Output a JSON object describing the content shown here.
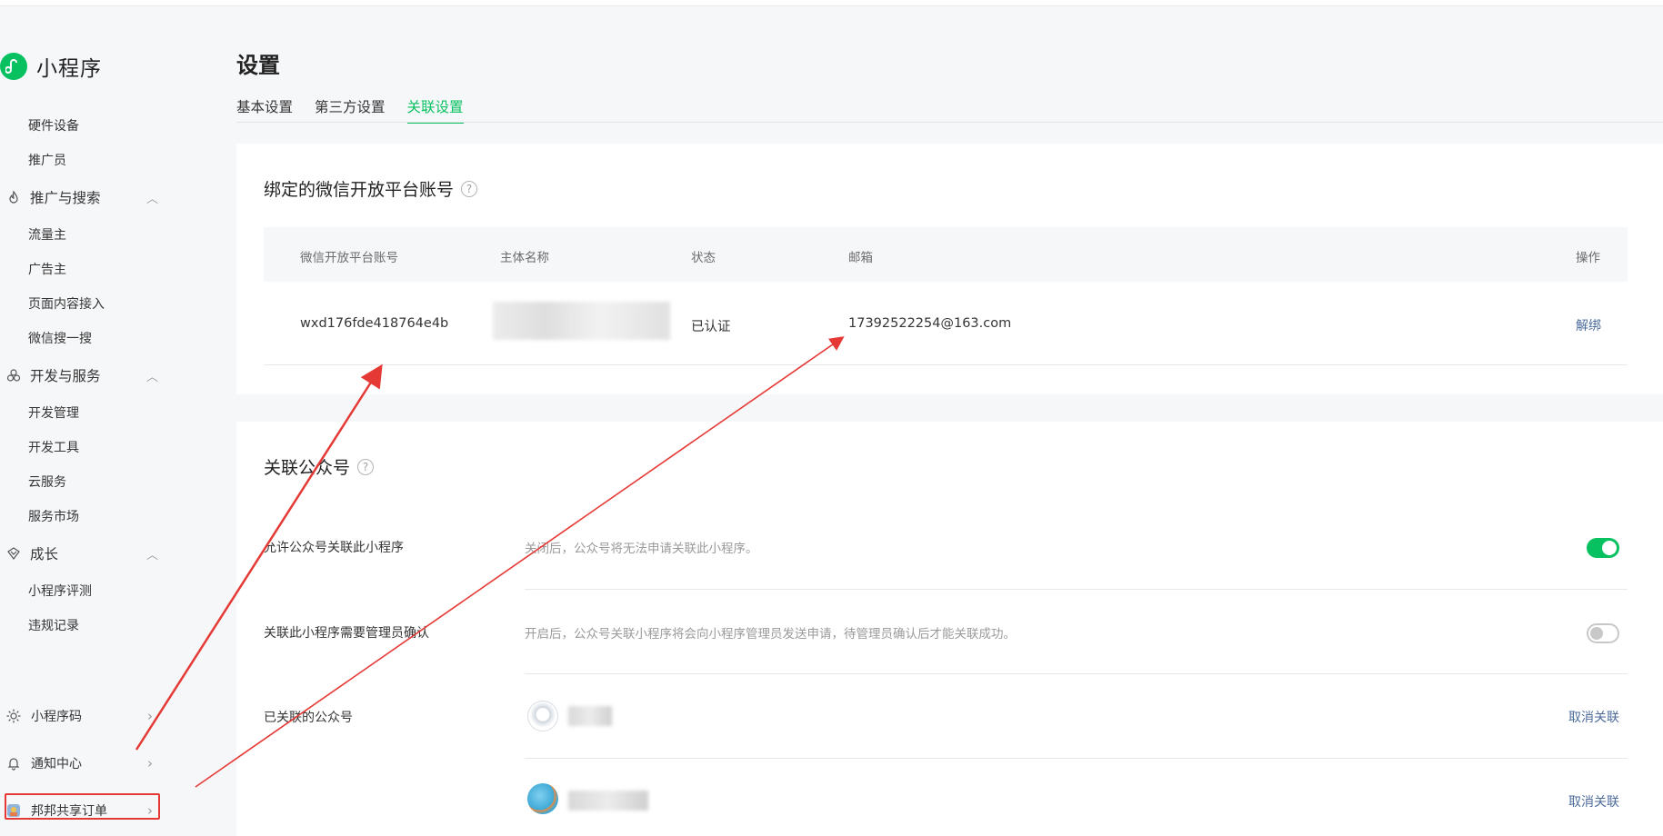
{
  "brand": {
    "name": "小程序"
  },
  "sidebar": {
    "top_items": [
      "硬件设备",
      "推广员"
    ],
    "groups": [
      {
        "label": "推广与搜索",
        "icon": "flame-icon",
        "items": [
          "流量主",
          "广告主",
          "页面内容接入",
          "微信搜一搜"
        ]
      },
      {
        "label": "开发与服务",
        "icon": "cluster-icon",
        "items": [
          "开发管理",
          "开发工具",
          "云服务",
          "服务市场"
        ]
      },
      {
        "label": "成长",
        "icon": "growth-icon",
        "items": [
          "小程序评测",
          "违规记录"
        ]
      }
    ],
    "bottom": [
      {
        "label": "小程序码",
        "icon": "sun-icon"
      },
      {
        "label": "通知中心",
        "icon": "bell-icon"
      },
      {
        "label": "邦邦共享订单",
        "icon": "app-avatar-icon"
      }
    ]
  },
  "page": {
    "title": "设置",
    "tabs": [
      "基本设置",
      "第三方设置",
      "关联设置"
    ],
    "active_tab": "关联设置"
  },
  "bound_account": {
    "title": "绑定的微信开放平台账号",
    "columns": [
      "微信开放平台账号",
      "主体名称",
      "状态",
      "邮箱",
      "操作"
    ],
    "row": {
      "account": "wxd176fde418764e4b",
      "status": "已认证",
      "email": "17392522254@163.com",
      "action": "解绑"
    }
  },
  "linked_oa": {
    "title": "关联公众号",
    "settings": [
      {
        "label": "允许公众号关联此小程序",
        "desc": "关闭后，公众号将无法申请关联此小程序。",
        "enabled": true
      },
      {
        "label": "关联此小程序需要管理员确认",
        "desc": "开启后，公众号关联小程序将会向小程序管理员发送申请，待管理员确认后才能关联成功。",
        "enabled": false
      }
    ],
    "linked_label": "已关联的公众号",
    "unlink_label": "取消关联"
  },
  "colors": {
    "accent": "#07c160",
    "link": "#4c6b9b",
    "annotation": "#e53935"
  }
}
